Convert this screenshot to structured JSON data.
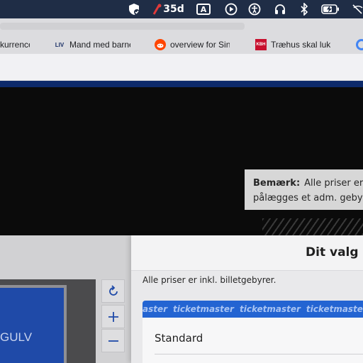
{
  "menubar": {
    "notification_count": "35d",
    "input_source": "A"
  },
  "tabs": [
    {
      "label": "kurrence",
      "favicon": "none"
    },
    {
      "label": "Mand med barne",
      "favicon": "liv-logo",
      "favicon_text": "LIV"
    },
    {
      "label": "overview for Sin",
      "favicon": "reddit-icon"
    },
    {
      "label": "Træhus skal lukk",
      "favicon": "kbh-logo",
      "favicon_text": "KBH"
    }
  ],
  "notice": {
    "bold": "Bemærk:",
    "line1": "Alle priser er",
    "line2": "pålægges et adm. geby"
  },
  "map": {
    "field_label": "GULV"
  },
  "panel": {
    "title": "Dit valg",
    "fees_note": "Alle priser er inkl. billetgebyrer.",
    "banner_words": [
      "aster",
      "ticketmaster",
      "ticketmaster",
      "ticketmaster",
      "ticketmas"
    ],
    "ticket_type": "Standard"
  },
  "colors": {
    "menubar": "#1f2d46",
    "brand_blue": "#1f4aa8",
    "ticketmaster_blue": "#2364d2",
    "nav_stripe": "#0d2a6b"
  }
}
